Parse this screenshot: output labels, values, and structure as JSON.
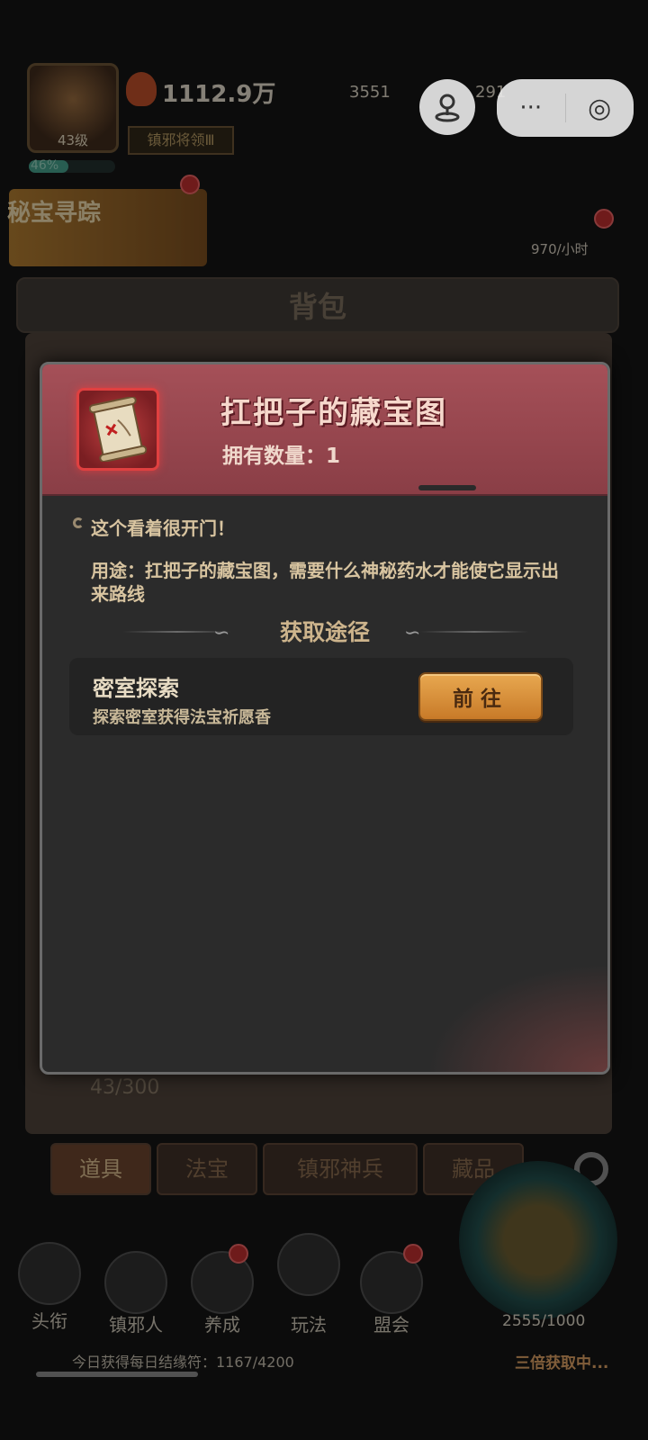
{
  "player": {
    "level": "43级",
    "exp_percent": "46%",
    "exp_fraction": 0.46,
    "power": "1112.9万",
    "gold": "3551",
    "gems": "291",
    "title_badge": "镇邪将领Ⅲ"
  },
  "banners": {
    "treasure": "秘宝寻踪",
    "income": "970/小时"
  },
  "bag": {
    "title": "背包",
    "count": "43/300",
    "tabs": [
      "道具",
      "法宝",
      "镇邪神兵",
      "藏品"
    ]
  },
  "bottom_nav": {
    "items": [
      "头衔",
      "镇邪人",
      "养成",
      "玩法",
      "盟会"
    ],
    "stamina": "2555/1000"
  },
  "footer": {
    "daily_text": "今日获得每日结缘符：1167/4200",
    "right_text": "三倍获取中..."
  },
  "capsule": {
    "more_glyph": "···",
    "close_glyph": "◎"
  },
  "popup": {
    "item_name": "扛把子的藏宝图",
    "owned_label": "拥有数量：1",
    "description": "这个看着很开门！",
    "usage": "用途：扛把子的藏宝图，需要什么神秘药水才能使它显示出来路线",
    "source_title": "获取途径",
    "sources": [
      {
        "name": "密室探索",
        "desc": "探索密室获得法宝祈愿香",
        "button": "前往"
      }
    ]
  },
  "colors": {
    "popup_header": "#a55058",
    "goto_button": "#e8a850",
    "background": "#0c0c0c"
  }
}
